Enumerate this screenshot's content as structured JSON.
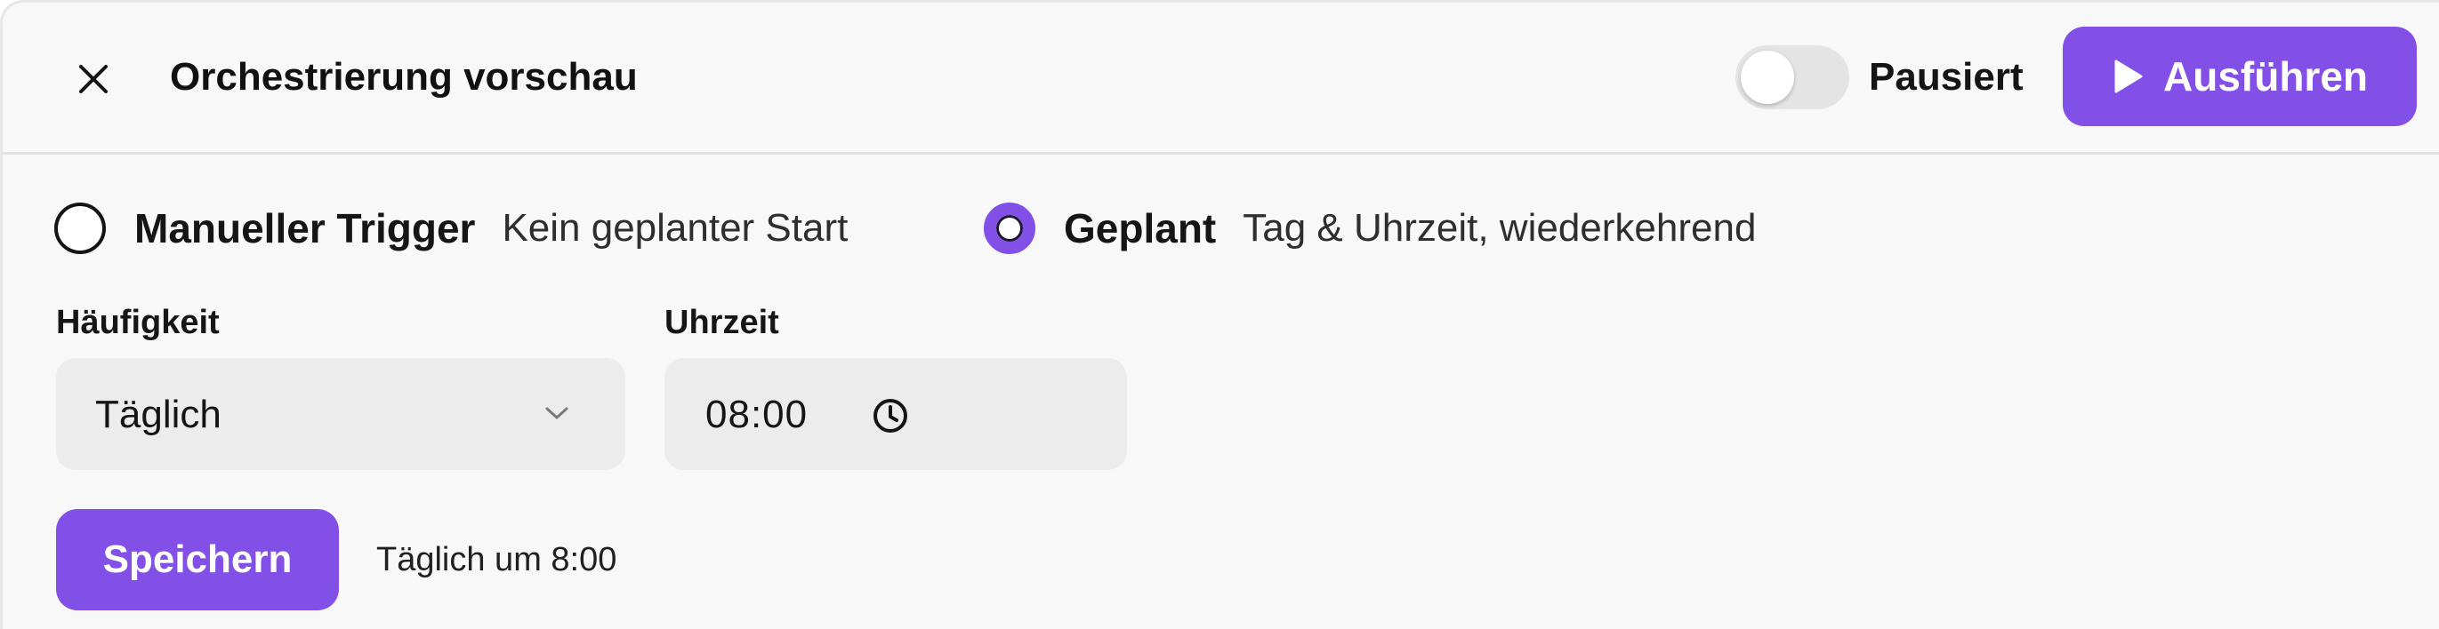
{
  "header": {
    "title": "Orchestrierung vorschau",
    "close_icon": "close-icon",
    "toggle": {
      "label": "Pausiert",
      "on": false
    },
    "run_button": {
      "label": "Ausführen",
      "icon": "play-icon"
    }
  },
  "trigger": {
    "options": [
      {
        "label": "Manueller Trigger",
        "description": "Kein geplanter Start",
        "selected": false
      },
      {
        "label": "Geplant",
        "description": "Tag & Uhrzeit, wiederkehrend",
        "selected": true
      }
    ]
  },
  "schedule": {
    "frequency": {
      "label": "Häufigkeit",
      "value": "Täglich",
      "icon": "chevron-down-icon"
    },
    "time": {
      "label": "Uhrzeit",
      "value": "08:00",
      "icon": "clock-icon"
    }
  },
  "footer": {
    "save_label": "Speichern",
    "summary": "Täglich um 8:00"
  },
  "colors": {
    "accent": "#8250e6",
    "panel_bg": "#f8f8f8",
    "field_bg": "#ececec"
  }
}
